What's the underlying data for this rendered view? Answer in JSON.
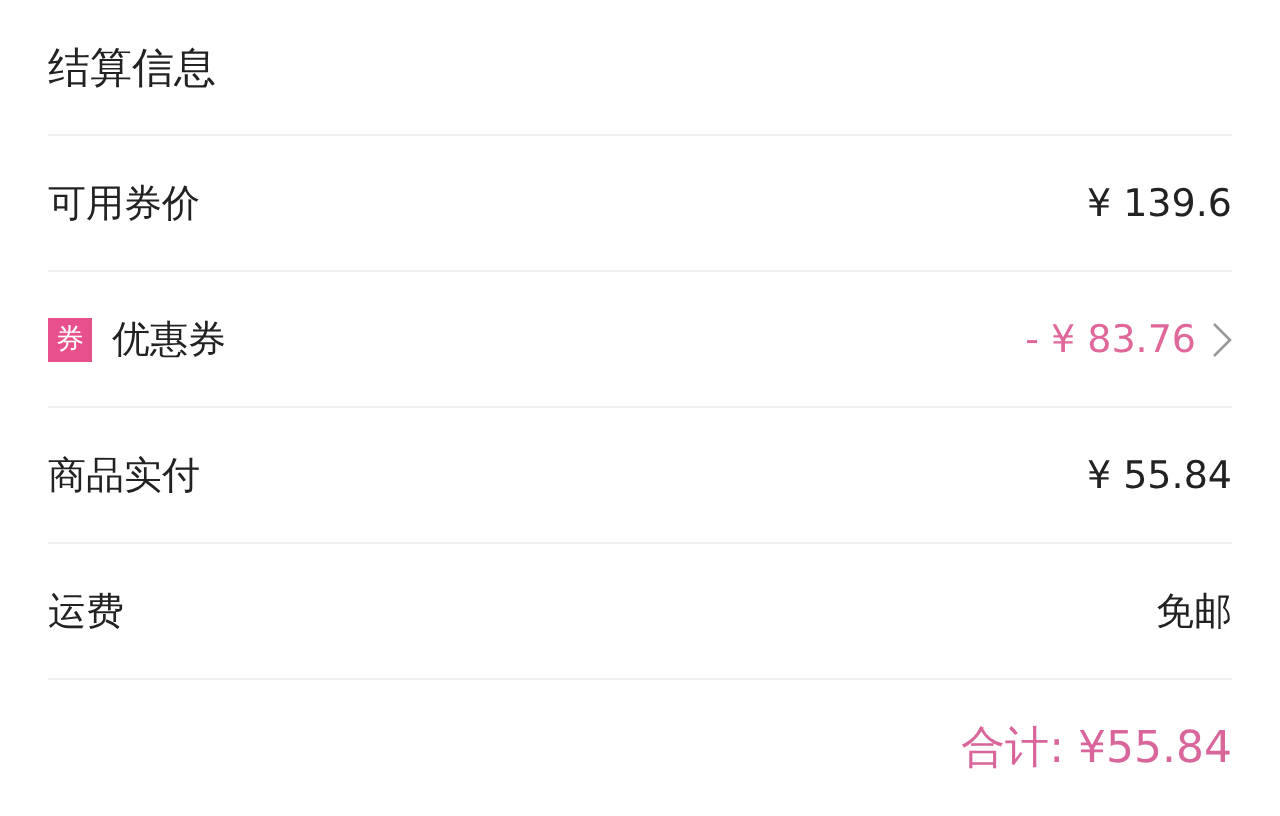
{
  "title": "结算信息",
  "rows": [
    {
      "kind": "plain",
      "label": "可用券价",
      "value": "¥ 139.6"
    },
    {
      "kind": "coupon",
      "badge": "券",
      "label": "优惠券",
      "value": "- ¥ 83.76"
    },
    {
      "kind": "plain",
      "label": "商品实付",
      "value": "¥ 55.84"
    },
    {
      "kind": "plain",
      "label": "运费",
      "value": "免邮"
    }
  ],
  "total": "合计: ¥55.84"
}
